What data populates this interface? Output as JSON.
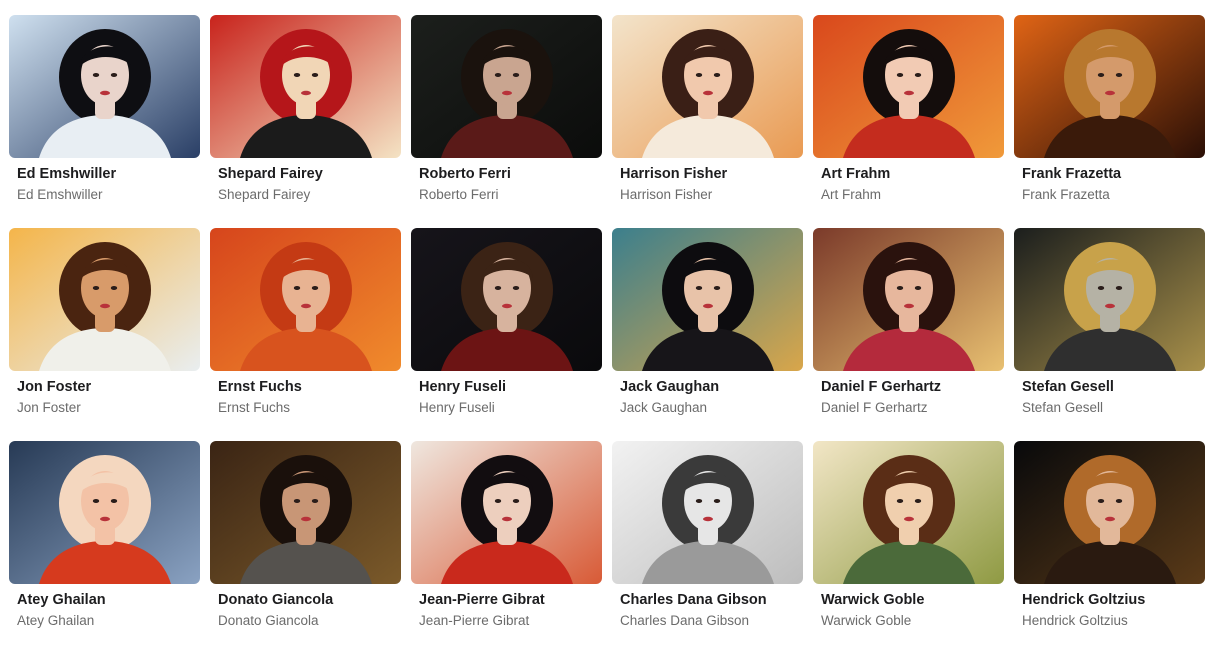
{
  "artists": [
    {
      "title": "Ed Emshwiller",
      "subtitle": "Ed Emshwiller",
      "bg": "#cfe0ef",
      "bg2": "#2a3f66",
      "hair": "#0e0e12",
      "skin": "#e9d4cb",
      "cloth": "#e8eef3"
    },
    {
      "title": "Shepard Fairey",
      "subtitle": "Shepard Fairey",
      "bg": "#c8231c",
      "bg2": "#f4e3c4",
      "hair": "#b5161a",
      "skin": "#f1d6b6",
      "cloth": "#1b1b1b"
    },
    {
      "title": "Roberto Ferri",
      "subtitle": "Roberto Ferri",
      "bg": "#1c1f1c",
      "bg2": "#0b0c0b",
      "hair": "#1a120d",
      "skin": "#c9a590",
      "cloth": "#5a1a18"
    },
    {
      "title": "Harrison Fisher",
      "subtitle": "Harrison Fisher",
      "bg": "#f3e4cb",
      "bg2": "#e99a52",
      "hair": "#3a1f16",
      "skin": "#f1c9ad",
      "cloth": "#f5eadb"
    },
    {
      "title": "Art Frahm",
      "subtitle": "Art Frahm",
      "bg": "#d9481c",
      "bg2": "#f09a3a",
      "hair": "#140d0c",
      "skin": "#f2cbb4",
      "cloth": "#c42c1e"
    },
    {
      "title": "Frank Frazetta",
      "subtitle": "Frank Frazetta",
      "bg": "#e06415",
      "bg2": "#2a0f06",
      "hair": "#b8782e",
      "skin": "#d49a6b",
      "cloth": "#3a1a0a"
    },
    {
      "title": "Jon Foster",
      "subtitle": "Jon Foster",
      "bg": "#f4b54a",
      "bg2": "#e9eef0",
      "hair": "#4a2410",
      "skin": "#d89b6a",
      "cloth": "#f0f0ea"
    },
    {
      "title": "Ernst Fuchs",
      "subtitle": "Ernst Fuchs",
      "bg": "#d6451c",
      "bg2": "#f08b2c",
      "hair": "#c43a14",
      "skin": "#e8b392",
      "cloth": "#d8531e"
    },
    {
      "title": "Henry Fuseli",
      "subtitle": "Henry Fuseli",
      "bg": "#16141a",
      "bg2": "#0a0a0c",
      "hair": "#3b2315",
      "skin": "#d7b39e",
      "cloth": "#6c1414"
    },
    {
      "title": "Jack Gaughan",
      "subtitle": "Jack Gaughan",
      "bg": "#3b7f8d",
      "bg2": "#d9a64a",
      "hair": "#0d0c0f",
      "skin": "#e8c3a9",
      "cloth": "#171519"
    },
    {
      "title": "Daniel F Gerhartz",
      "subtitle": "Daniel F Gerhartz",
      "bg": "#7b3a2a",
      "bg2": "#e8c071",
      "hair": "#2a120d",
      "skin": "#e7b79d",
      "cloth": "#b42a3c"
    },
    {
      "title": "Stefan Gesell",
      "subtitle": "Stefan Gesell",
      "bg": "#1b1e1d",
      "bg2": "#a8904a",
      "hair": "#c8a24a",
      "skin": "#b5b2a5",
      "cloth": "#2f2f2f"
    },
    {
      "title": "Atey Ghailan",
      "subtitle": "Atey Ghailan",
      "bg": "#273a55",
      "bg2": "#8aa2c2",
      "hair": "#f4d7bf",
      "skin": "#f3c2a6",
      "cloth": "#d63a1e"
    },
    {
      "title": "Donato Giancola",
      "subtitle": "Donato Giancola",
      "bg": "#3a2414",
      "bg2": "#7b5a2a",
      "hair": "#1a100b",
      "skin": "#c89676",
      "cloth": "#55524e"
    },
    {
      "title": "Jean-Pierre Gibrat",
      "subtitle": "Jean-Pierre Gibrat",
      "bg": "#efe7df",
      "bg2": "#d85a36",
      "hair": "#120d10",
      "skin": "#edcfbe",
      "cloth": "#c9291c"
    },
    {
      "title": "Charles Dana Gibson",
      "subtitle": "Charles Dana Gibson",
      "bg": "#f2f2f2",
      "bg2": "#bdbdbd",
      "hair": "#3a3a3a",
      "skin": "#e6e6e6",
      "cloth": "#9a9a9a"
    },
    {
      "title": "Warwick Goble",
      "subtitle": "Warwick Goble",
      "bg": "#f2e6c6",
      "bg2": "#8f9a43",
      "hair": "#5a2d16",
      "skin": "#f0cfae",
      "cloth": "#4b6a3a"
    },
    {
      "title": "Hendrick Goltzius",
      "subtitle": "Hendrick Goltzius",
      "bg": "#08090b",
      "bg2": "#5a3a18",
      "hair": "#b06a2a",
      "skin": "#e2b89a",
      "cloth": "#2a1a10"
    }
  ]
}
